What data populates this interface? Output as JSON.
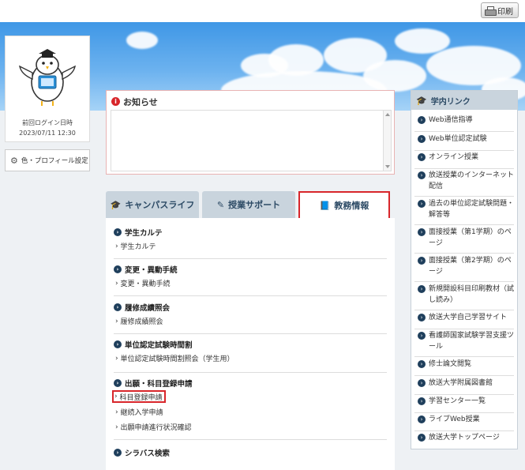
{
  "header": {
    "print_label": "印刷"
  },
  "user": {
    "last_login_label": "前回ログイン日時",
    "last_login_value": "2023/07/11 12:30"
  },
  "profile_button": {
    "label": "色・プロフィール設定"
  },
  "notice": {
    "title": "お知らせ"
  },
  "tabs": [
    {
      "label": "キャンパスライフ",
      "icon": "graduation-cap-icon"
    },
    {
      "label": "授業サポート",
      "icon": "pencil-icon"
    },
    {
      "label": "教務情報",
      "icon": "book-icon",
      "active": true
    }
  ],
  "sections": [
    {
      "title": "学生カルテ",
      "links": [
        "学生カルテ"
      ]
    },
    {
      "title": "変更・異動手続",
      "links": [
        "変更・異動手続"
      ]
    },
    {
      "title": "履修成績照会",
      "links": [
        "履修成績照会"
      ]
    },
    {
      "title": "単位認定試験時間割",
      "links": [
        "単位認定試験時間割照会（学生用）"
      ]
    },
    {
      "title": "出願・科目登録申請",
      "links": [
        "科目登録申請",
        "継続入学申請",
        "出願申請進行状況確認"
      ]
    },
    {
      "title": "シラバス検索",
      "links": []
    }
  ],
  "sidebar": {
    "title": "学内リンク",
    "items": [
      "Web通信指導",
      "Web単位認定試験",
      "オンライン授業",
      "放送授業のインターネット配信",
      "過去の単位認定試験問題・解答等",
      "面接授業（第1学期）のページ",
      "面接授業（第2学期）のページ",
      "新規開設科目印刷教材（試し読み）",
      "放送大学自己学習サイト",
      "看護師国家試験学習支援ツール",
      "修士論文閲覧",
      "放送大学附属図書館",
      "学習センター一覧",
      "ライブWeb授業",
      "放送大学トップページ"
    ]
  }
}
